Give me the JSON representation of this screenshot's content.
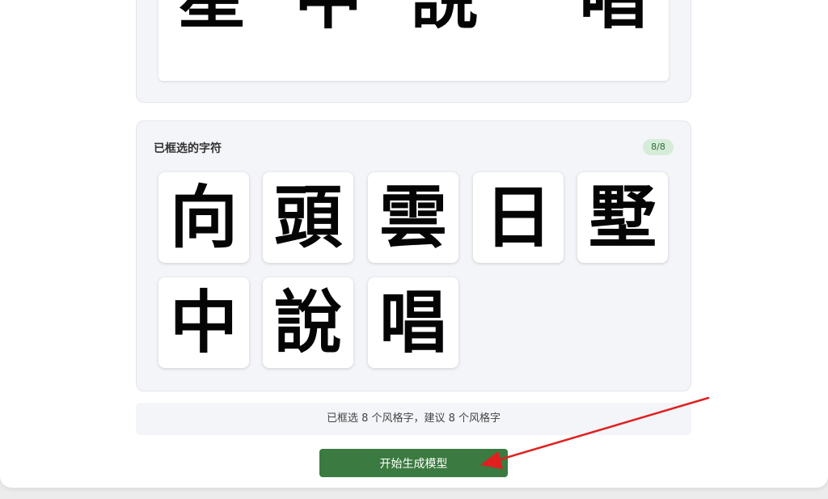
{
  "preview": {
    "glyphs": [
      "星",
      "中",
      "說",
      "唱"
    ]
  },
  "selected": {
    "title": "已框选的字符",
    "badge": "8/8",
    "characters": [
      "向",
      "頭",
      "雲",
      "日",
      "墅",
      "中",
      "說",
      "唱"
    ]
  },
  "summary": {
    "text": "已框选 8 个风格字，建议 8 个风格字"
  },
  "actions": {
    "start_label": "开始生成模型"
  },
  "colors": {
    "primary_button": "#3b7a40",
    "badge_bg": "#d5ecd9",
    "annotation_arrow": "#e02020"
  }
}
